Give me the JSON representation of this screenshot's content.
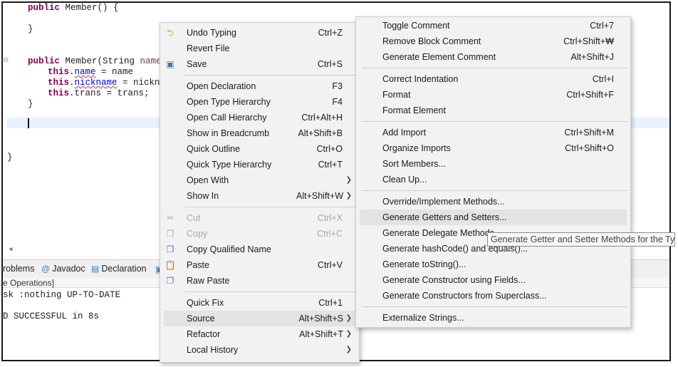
{
  "editor": {
    "lines": [
      {
        "parts": [
          {
            "t": "public ",
            "c": "kw"
          },
          {
            "t": "Member() {",
            "c": ""
          }
        ]
      },
      {
        "parts": [
          {
            "t": "}",
            "c": ""
          }
        ]
      },
      {
        "parts": [
          {
            "t": "public ",
            "c": "kw"
          },
          {
            "t": "Member(String ",
            "c": ""
          },
          {
            "t": "name",
            "c": "param"
          },
          {
            "t": ",",
            "c": ""
          }
        ]
      },
      {
        "parts": [
          {
            "t": "this",
            "c": "kw"
          },
          {
            "t": ".",
            "c": ""
          },
          {
            "t": "name",
            "c": "fld squig"
          },
          {
            "t": " = name",
            "c": ""
          }
        ]
      },
      {
        "parts": [
          {
            "t": "this",
            "c": "kw"
          },
          {
            "t": ".",
            "c": ""
          },
          {
            "t": "nickname",
            "c": "fld squig"
          },
          {
            "t": " = nicknam",
            "c": ""
          }
        ]
      },
      {
        "parts": [
          {
            "t": "this",
            "c": "kw"
          },
          {
            "t": ".trans = trans;",
            "c": ""
          }
        ]
      },
      {
        "parts": [
          {
            "t": "}",
            "c": ""
          }
        ]
      },
      {
        "parts": [
          {
            "t": "}",
            "c": ""
          }
        ]
      }
    ]
  },
  "panel": {
    "tabs": [
      {
        "label": "roblems",
        "icon": ""
      },
      {
        "label": "Javadoc",
        "icon": "@"
      },
      {
        "label": "Declaration",
        "icon": "declaration-icon"
      }
    ],
    "status": "e Operations]",
    "console": [
      "sk :nothing UP-TO-DATE",
      "",
      "D SUCCESSFUL in 8s"
    ]
  },
  "context_menu": {
    "items": [
      {
        "label": "Undo Typing",
        "accel": "Ctrl+Z",
        "icon": "undo-icon"
      },
      {
        "label": "Revert File",
        "accel": ""
      },
      {
        "label": "Save",
        "accel": "Ctrl+S",
        "icon": "save-icon"
      },
      {
        "sep": true
      },
      {
        "label": "Open Declaration",
        "accel": "F3"
      },
      {
        "label": "Open Type Hierarchy",
        "accel": "F4"
      },
      {
        "label": "Open Call Hierarchy",
        "accel": "Ctrl+Alt+H"
      },
      {
        "label": "Show in Breadcrumb",
        "accel": "Alt+Shift+B"
      },
      {
        "label": "Quick Outline",
        "accel": "Ctrl+O"
      },
      {
        "label": "Quick Type Hierarchy",
        "accel": "Ctrl+T"
      },
      {
        "label": "Open With",
        "accel": "",
        "submenu": true
      },
      {
        "label": "Show In",
        "accel": "Alt+Shift+W",
        "submenu": true
      },
      {
        "sep": true
      },
      {
        "label": "Cut",
        "accel": "Ctrl+X",
        "icon": "cut-icon",
        "disabled": true
      },
      {
        "label": "Copy",
        "accel": "Ctrl+C",
        "icon": "copy-icon",
        "disabled": true
      },
      {
        "label": "Copy Qualified Name",
        "accel": "",
        "icon": "copy-qualified-icon"
      },
      {
        "label": "Paste",
        "accel": "Ctrl+V",
        "icon": "paste-icon"
      },
      {
        "label": "Raw Paste",
        "accel": "",
        "icon": "raw-paste-icon"
      },
      {
        "sep": true
      },
      {
        "label": "Quick Fix",
        "accel": "Ctrl+1"
      },
      {
        "label": "Source",
        "accel": "Alt+Shift+S",
        "submenu": true,
        "highlighted": true
      },
      {
        "label": "Refactor",
        "accel": "Alt+Shift+T",
        "submenu": true
      },
      {
        "label": "Local History",
        "accel": "",
        "submenu": true
      }
    ]
  },
  "source_menu": {
    "items": [
      {
        "label": "Toggle Comment",
        "accel": "Ctrl+7"
      },
      {
        "label": "Remove Block Comment",
        "accel": "Ctrl+Shift+₩"
      },
      {
        "label": "Generate Element Comment",
        "accel": "Alt+Shift+J"
      },
      {
        "sep": true
      },
      {
        "label": "Correct Indentation",
        "accel": "Ctrl+I"
      },
      {
        "label": "Format",
        "accel": "Ctrl+Shift+F"
      },
      {
        "label": "Format Element",
        "accel": ""
      },
      {
        "sep": true
      },
      {
        "label": "Add Import",
        "accel": "Ctrl+Shift+M"
      },
      {
        "label": "Organize Imports",
        "accel": "Ctrl+Shift+O"
      },
      {
        "label": "Sort Members...",
        "accel": ""
      },
      {
        "label": "Clean Up...",
        "accel": ""
      },
      {
        "sep": true
      },
      {
        "label": "Override/Implement Methods...",
        "accel": ""
      },
      {
        "label": "Generate Getters and Setters...",
        "accel": "",
        "highlighted": true
      },
      {
        "label": "Generate Delegate Methods...",
        "accel": ""
      },
      {
        "label": "Generate hashCode() and equals()...",
        "accel": ""
      },
      {
        "label": "Generate toString()...",
        "accel": ""
      },
      {
        "label": "Generate Constructor using Fields...",
        "accel": ""
      },
      {
        "label": "Generate Constructors from Superclass...",
        "accel": ""
      },
      {
        "sep": true
      },
      {
        "label": "Externalize Strings...",
        "accel": ""
      }
    ]
  },
  "tooltip": "Generate Getter and Setter Methods for the Typ",
  "colors": {
    "keyword": "#7f0055",
    "field": "#0000c0",
    "param": "#6a3e3e",
    "menu_bg": "#f2f2f2",
    "highlight": "#e3e3e3"
  }
}
